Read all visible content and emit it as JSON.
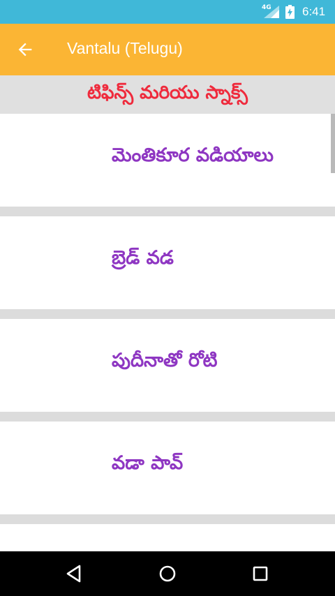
{
  "status_bar": {
    "network": "4G",
    "time": "6:41",
    "icons": [
      "signal-icon",
      "battery-charging-icon"
    ]
  },
  "app_bar": {
    "title": "Vantalu (Telugu)",
    "back_icon": "arrow-back-icon"
  },
  "section": {
    "title": "టిఫిన్స్ మరియు  స్నాక్స్"
  },
  "recipes": [
    {
      "label": "మెంతికూర వడియాలు"
    },
    {
      "label": "బ్రెడ్ వడ"
    },
    {
      "label": "పుదీనాతో రోటి"
    },
    {
      "label": "వడా పావ్"
    },
    {
      "label": ""
    }
  ],
  "nav_bar": {
    "icons": [
      "back-triangle-icon",
      "home-circle-icon",
      "recents-square-icon"
    ]
  },
  "colors": {
    "status_bar": "#40b8d8",
    "app_bar": "#fbb534",
    "section_title": "#ef2a3c",
    "item_text": "#8e36c2",
    "separator": "#dcdcdc"
  }
}
